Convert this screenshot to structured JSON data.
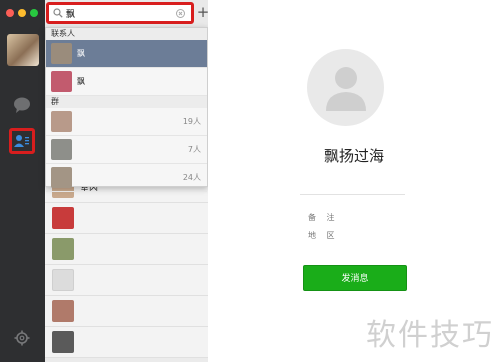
{
  "search": {
    "value": "飘"
  },
  "toolbar": {
    "plus_label": "+"
  },
  "dropdown": {
    "contacts_header": "联系人",
    "contacts": [
      {
        "name": "飘",
        "avatar": "#9a8c7c"
      },
      {
        "name": "飘",
        "avatar": "#c25b6e"
      }
    ],
    "groups_header": "群",
    "groups": [
      {
        "name": "",
        "count": "19人",
        "avatar": "#b89a8a"
      },
      {
        "name": "",
        "count": "7人",
        "avatar": "#8e8f8a"
      },
      {
        "name": "",
        "count": "24人",
        "avatar": "#a39585"
      }
    ]
  },
  "list": {
    "items": [
      {
        "name": "室内",
        "avatar": "#c9a98d"
      },
      {
        "name": "",
        "avatar": "#c83b3b"
      },
      {
        "name": "",
        "avatar": "#8a9a6a"
      },
      {
        "name": "",
        "avatar": "#dcdcdc"
      },
      {
        "name": "",
        "avatar": "#b07a6a"
      },
      {
        "name": "",
        "avatar": "#5a5a5a"
      }
    ]
  },
  "profile": {
    "name": "飘扬过海",
    "remark_label": "备 注",
    "region_label": "地 区",
    "send_label": "发消息"
  },
  "watermark": "软件技巧",
  "colors": {
    "accent": "#1aad19",
    "highlight": "#d81e1e",
    "selected": "#6c7d97",
    "sidebar": "#2e2f31"
  }
}
